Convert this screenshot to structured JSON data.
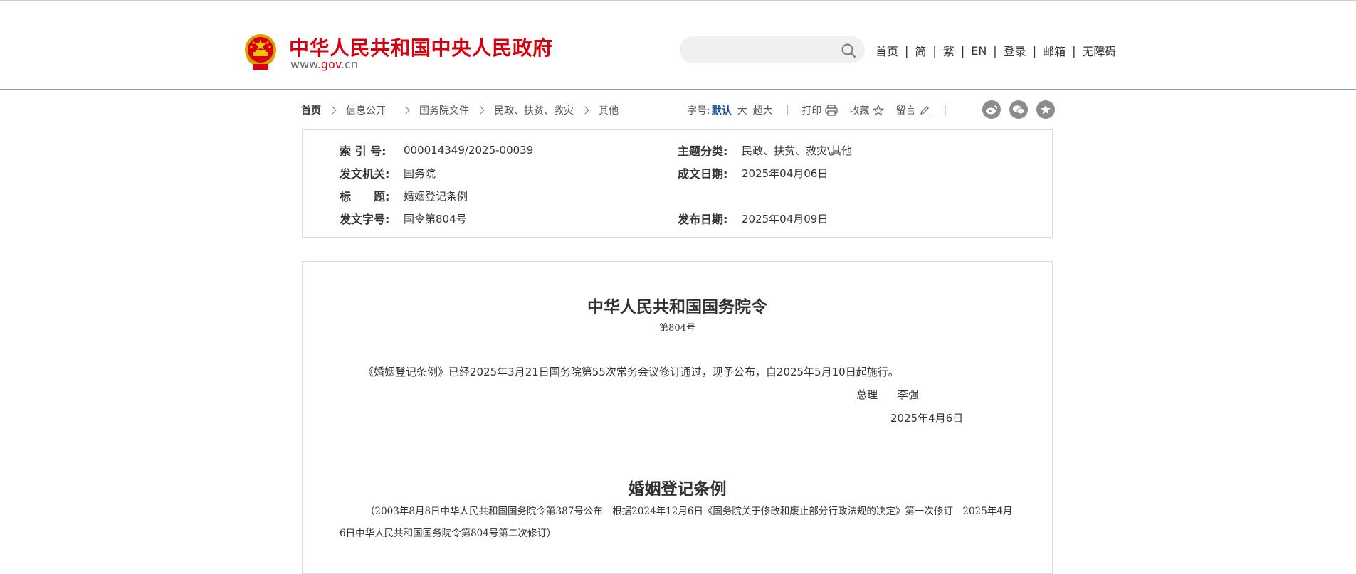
{
  "header": {
    "title": "中华人民共和国中央人民政府",
    "domain_prefix": "www.",
    "domain_highlight": "gov",
    "domain_suffix": ".cn",
    "emblem_icon": "national-emblem-icon",
    "search": {
      "placeholder": "",
      "value": "",
      "icon": "search-icon"
    },
    "nav": [
      "首页",
      "简",
      "繁",
      "EN",
      "登录",
      "邮箱",
      "无障碍"
    ],
    "nav_separator": "|"
  },
  "breadcrumb": {
    "items": [
      "首页",
      "信息公开",
      "国务院文件",
      "民政、扶贫、救灾",
      "其他"
    ]
  },
  "tools": {
    "font_size_label": "字号:",
    "font_default": "默认",
    "font_large": "大",
    "font_xlarge": "超大",
    "separator": "|",
    "print": "打印",
    "favorite": "收藏",
    "comment": "留言"
  },
  "share": [
    "weibo-icon",
    "wechat-icon",
    "star-share-icon"
  ],
  "info": {
    "index_label": "索 引 号:",
    "index_value": "000014349/2025-00039",
    "topic_label": "主题分类:",
    "topic_value": "民政、扶贫、救灾\\其他",
    "issuer_label": "发文机关:",
    "issuer_value": "国务院",
    "date_written_label": "成文日期:",
    "date_written_value": "2025年04月06日",
    "title_label": "标　　题:",
    "title_value": "婚姻登记条例",
    "doc_no_label": "发文字号:",
    "doc_no_value": "国令第804号",
    "publish_date_label": "发布日期:",
    "publish_date_value": "2025年04月09日"
  },
  "article": {
    "order_title": "中华人民共和国国务院令",
    "order_no": "第804号",
    "decree": "《婚姻登记条例》已经2025年3月21日国务院第55次常务会议修订通过，现予公布，自2025年5月10日起施行。",
    "premier_title": "总理",
    "premier_name": "李强",
    "sign_date": "2025年4月6日",
    "regulation_title": "婚姻登记条例",
    "history": "（2003年8月8日中华人民共和国国务院令第387号公布　根据2024年12月6日《国务院关于修改和废止部分行政法规的决定》第一次修订　2025年4月6日中华人民共和国国务院令第804号第二次修订）"
  },
  "colors": {
    "brand_red": "#d7000f",
    "link_blue": "#1a4c9c",
    "rule": "#8a9db4"
  }
}
